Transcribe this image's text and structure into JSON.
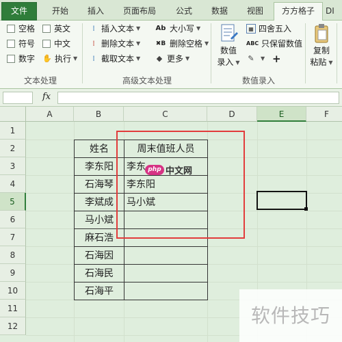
{
  "tabs": [
    {
      "label": "文件"
    },
    {
      "label": "开始"
    },
    {
      "label": "插入"
    },
    {
      "label": "页面布局"
    },
    {
      "label": "公式"
    },
    {
      "label": "数据"
    },
    {
      "label": "视图"
    },
    {
      "label": "方方格子"
    },
    {
      "label": "DI"
    }
  ],
  "ribbon": {
    "text_group": {
      "label": "文本处理",
      "checks": [
        "空格",
        "英文",
        "符号",
        "中文",
        "数字"
      ],
      "execute": "执行"
    },
    "advanced_group": {
      "label": "高级文本处理",
      "items": [
        "插入文本",
        "删除文本",
        "截取文本",
        "大小写",
        "删除空格",
        "更多"
      ]
    },
    "number_group": {
      "label": "数值录入",
      "big_button": [
        "数值",
        "录入"
      ],
      "items": [
        "四舍五入",
        "只保留数值"
      ],
      "plus": "+"
    },
    "copy_group": {
      "big_button": [
        "复制",
        "粘贴"
      ]
    }
  },
  "formula_bar": {
    "fx": "fx",
    "name_box": "",
    "content": ""
  },
  "sheet": {
    "columns": [
      "A",
      "B",
      "C",
      "D",
      "E",
      "F"
    ],
    "rows": [
      "1",
      "2",
      "3",
      "4",
      "5",
      "6",
      "7",
      "8",
      "9",
      "10",
      "11",
      "12"
    ],
    "header_b": "姓名",
    "header_c": "周末值班人员",
    "names": [
      "李东阳",
      "石海琴",
      "李斌成",
      "马小斌",
      "麻石浩",
      "石海因",
      "石海民",
      "石海平"
    ],
    "duty": [
      "李东",
      "李东阳",
      "马小斌"
    ],
    "active_cell": "E5"
  },
  "overlays": {
    "php_logo": "php",
    "php_text": "中文网",
    "watermark": "软件技巧"
  }
}
